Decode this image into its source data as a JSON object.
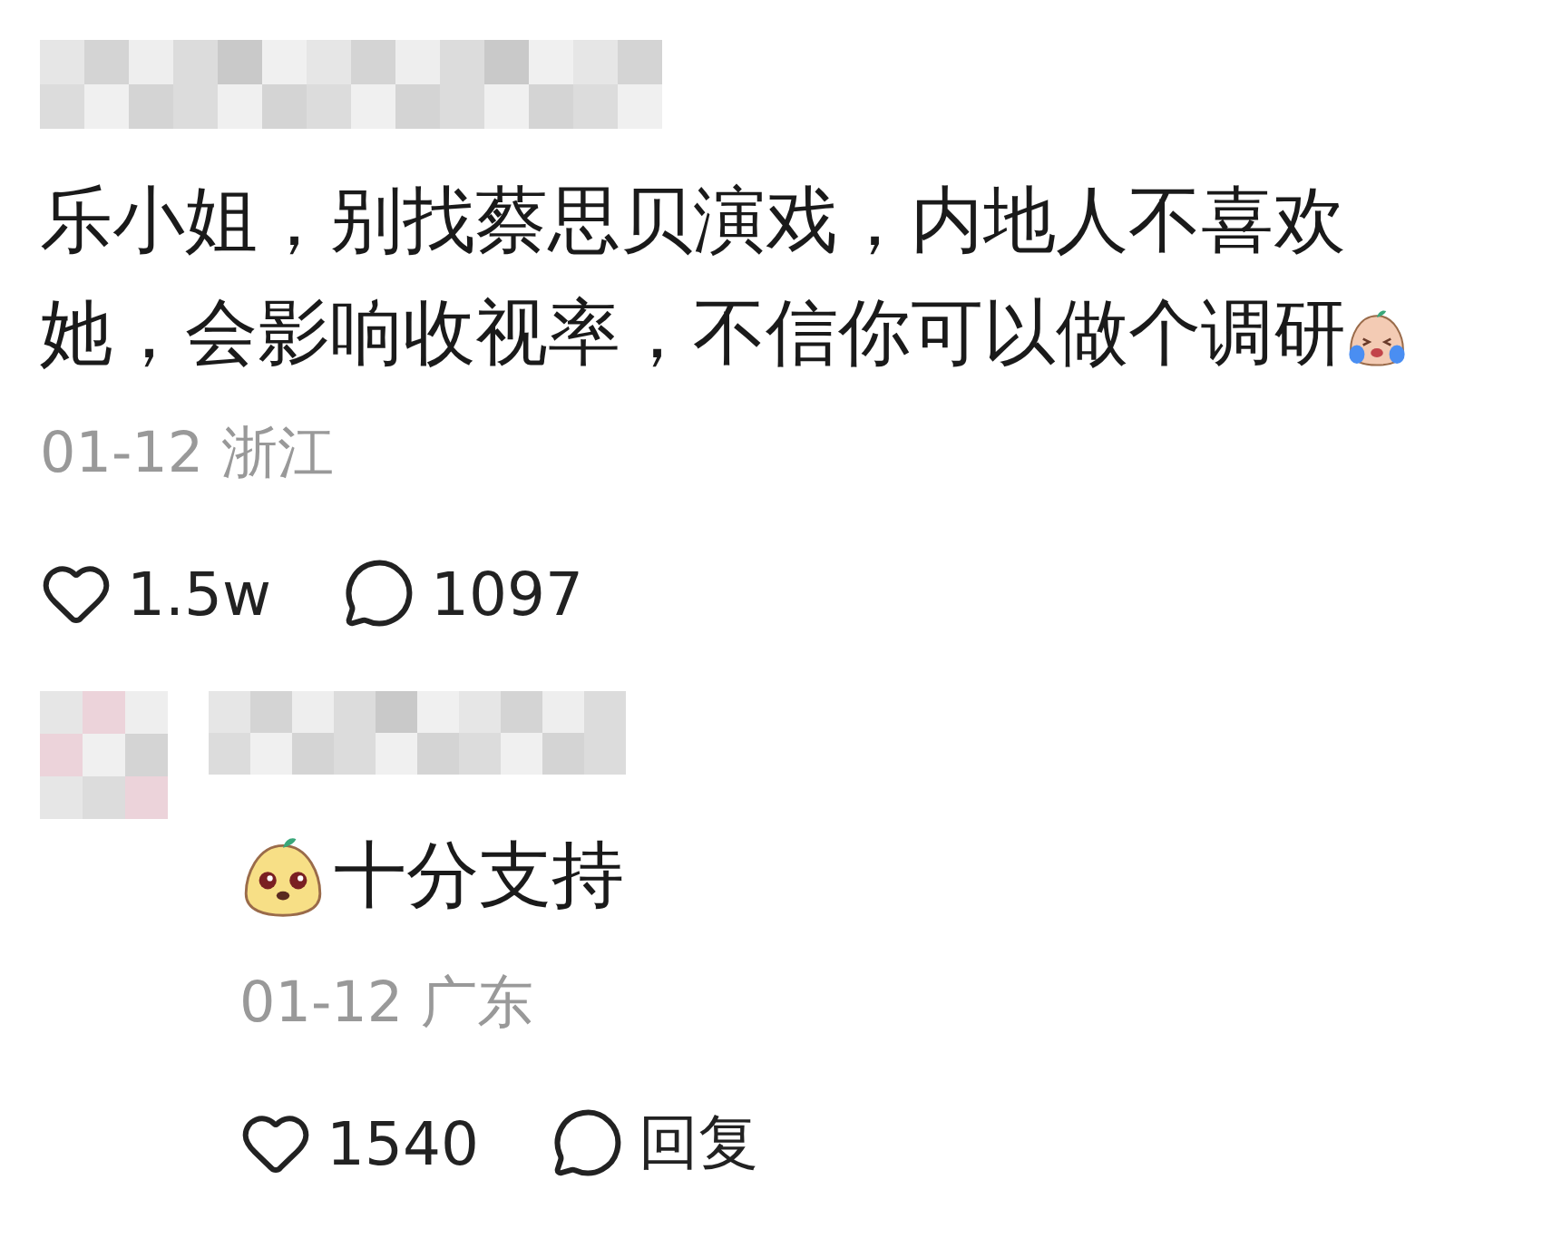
{
  "comment": {
    "text": "乐小姐，别找蔡思贝演戏，内地人不喜欢她，会影响收视率，不信你可以做个调研",
    "meta": "01-12 浙江",
    "likes": "1.5w",
    "replies": "1097"
  },
  "reply": {
    "text": "十分支持",
    "meta": "01-12 广东",
    "likes": "1540",
    "reply_label": "回复"
  }
}
